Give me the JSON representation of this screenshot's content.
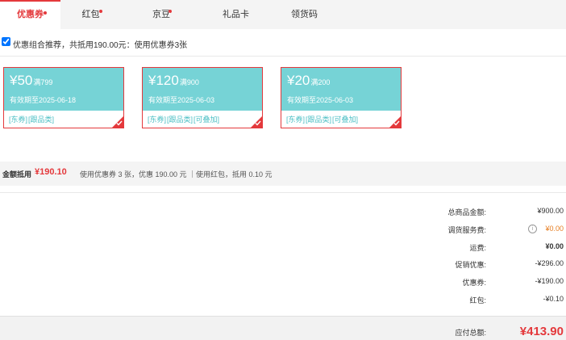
{
  "tabs": [
    {
      "label": "优惠券",
      "active": true,
      "dot": true
    },
    {
      "label": "红包",
      "active": false,
      "dot": true
    },
    {
      "label": "京豆",
      "active": false,
      "dot": true
    },
    {
      "label": "礼品卡",
      "active": false,
      "dot": false
    },
    {
      "label": "领货码",
      "active": false,
      "dot": false
    }
  ],
  "combo": {
    "text": "优惠组合推荐，共抵用190.00元：使用优惠券3张",
    "checked": true
  },
  "coupons": [
    {
      "amount": "¥50",
      "condition": "满799",
      "expiry": "有效期至2025-06-18",
      "tags": [
        "[东券]",
        "[跟品类]"
      ]
    },
    {
      "amount": "¥120",
      "condition": "满900",
      "expiry": "有效期至2025-06-03",
      "tags": [
        "[东券]",
        "[跟品类]",
        "[可叠加]"
      ]
    },
    {
      "amount": "¥20",
      "condition": "满200",
      "expiry": "有效期至2025-06-03",
      "tags": [
        "[东券]",
        "[跟品类]",
        "[可叠加]"
      ]
    }
  ],
  "summary": {
    "label": "金额抵用",
    "value": "¥190.10",
    "desc": "使用优惠券 3 张，优惠 190.00 元 ｜使用红包，抵用 0.10 元"
  },
  "fees": [
    {
      "key": "总商品金额:",
      "value": "¥900.00",
      "style": ""
    },
    {
      "key": "调货服务费:",
      "value": "¥0.00",
      "style": "orange",
      "info": true
    },
    {
      "key": "运费:",
      "value": "¥0.00",
      "style": "bold"
    },
    {
      "key": "促销优惠:",
      "value": "-¥296.00",
      "style": ""
    },
    {
      "key": "优惠券:",
      "value": "-¥190.00",
      "style": ""
    },
    {
      "key": "红包:",
      "value": "-¥0.10",
      "style": ""
    }
  ],
  "total": {
    "key": "应付总额:",
    "value": "¥413.90"
  },
  "colors": {
    "accent": "#e4393c",
    "coupon_bg": "#76d3d6",
    "tag": "#4bbfc4"
  }
}
